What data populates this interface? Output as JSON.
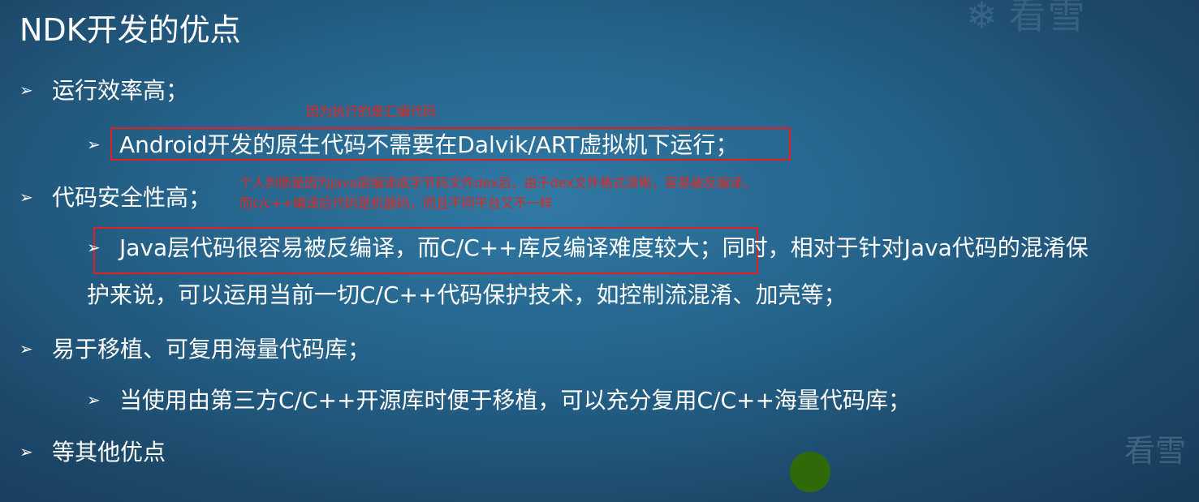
{
  "slide": {
    "title": "NDK开发的优点",
    "bullets": {
      "b1": "运行效率高；",
      "b1_sub": "Android开发的原生代码不需要在Dalvik/ART虚拟机下运行；",
      "b2": "代码安全性高；",
      "b2_sub_line1": "Java层代码很容易被反编译，而C/C++库反编译难度较大；同时，相对于针对Java代码的混淆保",
      "b2_sub_line2": "护来说，可以运用当前一切C/C++代码保护技术，如控制流混淆、加壳等；",
      "b3": "易于移植、可复用海量代码库；",
      "b3_sub": "当使用由第三方C/C++开源库时便于移植，可以充分复用C/C++海量代码库；",
      "b4": "等其他优点"
    },
    "bullet_glyph": "➢"
  },
  "annotations": {
    "a1": "因为执行的是汇编代码",
    "a2_line1": "个人判断是因为java层编译成字节码文件dex后，由于dex文件格式清晰，容易被反编译，",
    "a2_line2": "而c/c++编译后代码是机器码，而且不同平台又不一样"
  },
  "watermark": {
    "top_text": "看雪",
    "bottom_text": "看雪",
    "icon": "snowflake-icon"
  },
  "colors": {
    "annotation_red": "#e3271f",
    "box_red": "#e51f1f",
    "dot_green": "#2f6a07"
  }
}
